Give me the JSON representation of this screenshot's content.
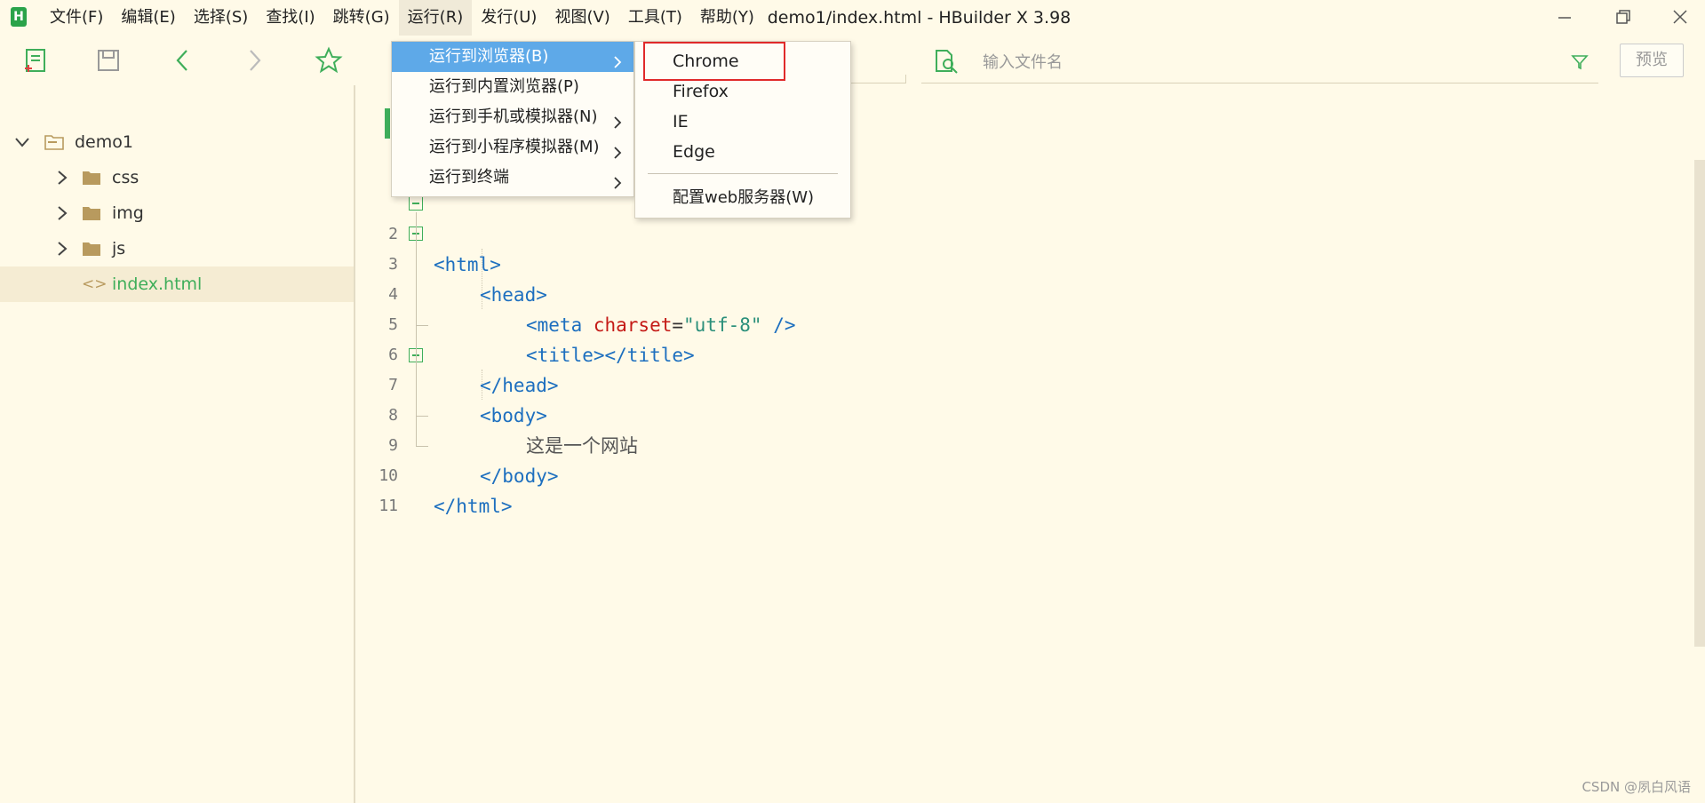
{
  "app": {
    "logo_letter": "H",
    "window_title": "demo1/index.html - HBuilder X 3.98"
  },
  "menubar": {
    "items": [
      "文件(F)",
      "编辑(E)",
      "选择(S)",
      "查找(I)",
      "跳转(G)",
      "运行(R)",
      "发行(U)",
      "视图(V)",
      "工具(T)",
      "帮助(Y)"
    ],
    "active_index": 5
  },
  "toolbar": {
    "icons": [
      "new-file-icon",
      "save-icon",
      "back-icon",
      "forward-icon",
      "favorite-icon"
    ],
    "search_placeholder": "输入文件名",
    "preview_label": "预览"
  },
  "sidebar": {
    "project": "demo1",
    "items": [
      {
        "label": "css",
        "type": "folder"
      },
      {
        "label": "img",
        "type": "folder"
      },
      {
        "label": "js",
        "type": "folder"
      },
      {
        "label": "index.html",
        "type": "file",
        "selected": true
      }
    ]
  },
  "editor": {
    "lines": [
      {
        "no": "2",
        "code": "<html>"
      },
      {
        "no": "3",
        "code": "<head>"
      },
      {
        "no": "4",
        "code": "<meta charset=\"utf-8\" />"
      },
      {
        "no": "5",
        "code": "<title></title>"
      },
      {
        "no": "6",
        "code": "</head>"
      },
      {
        "no": "7",
        "code": "<body>"
      },
      {
        "no": "8",
        "code": "这是一个网站"
      },
      {
        "no": "9",
        "code": "</body>"
      },
      {
        "no": "10",
        "code": "</html>"
      },
      {
        "no": "11",
        "code": ""
      }
    ]
  },
  "run_menu": {
    "items": [
      {
        "label": "运行到浏览器(B)",
        "submenu": true,
        "highlighted": true
      },
      {
        "label": "运行到内置浏览器(P)",
        "submenu": false
      },
      {
        "label": "运行到手机或模拟器(N)",
        "submenu": true
      },
      {
        "label": "运行到小程序模拟器(M)",
        "submenu": true
      },
      {
        "label": "运行到终端",
        "submenu": true
      }
    ]
  },
  "browser_submenu": {
    "items": [
      "Chrome",
      "Firefox",
      "IE",
      "Edge"
    ],
    "config_item": "配置web服务器(W)",
    "outlined_item": "Chrome",
    "outline_color": "#e02a2a"
  },
  "colors": {
    "accent": "#3fae5a",
    "menu_highlight": "#5ea9e8",
    "background": "#fffae8"
  },
  "watermark": "CSDN @夙白风语"
}
